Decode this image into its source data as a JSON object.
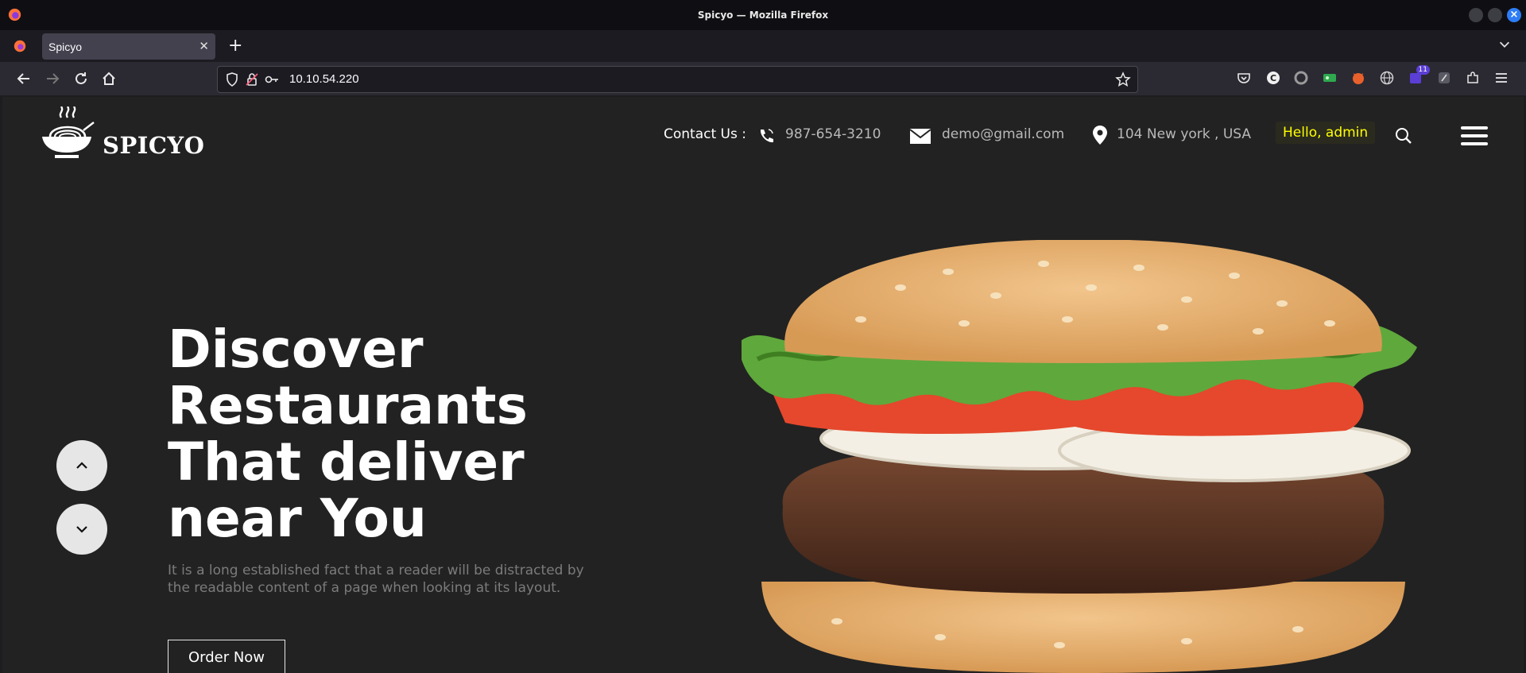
{
  "window": {
    "title": "Spicyo — Mozilla Firefox"
  },
  "tabs": [
    {
      "label": "Spicyo",
      "active": true
    }
  ],
  "urlbar": {
    "url": "10.10.54.220"
  },
  "extensions": {
    "badge_count": "11"
  },
  "site": {
    "brand": "SPICYO",
    "contact_label": "Contact Us :",
    "phone": "987-654-3210",
    "email": "demo@gmail.com",
    "address": "104 New york , USA",
    "greeting": "Hello, admin"
  },
  "hero": {
    "title_lines": [
      "Discover",
      "Restaurants",
      "That deliver",
      "near You"
    ],
    "description": "It is a long established fact that a reader will be distracted by the readable content of a page when looking at its layout.",
    "cta_label": "Order Now"
  },
  "colors": {
    "greeting_text": "#ffff00",
    "page_bg": "#222222",
    "chrome_bg": "#2b2a33"
  }
}
